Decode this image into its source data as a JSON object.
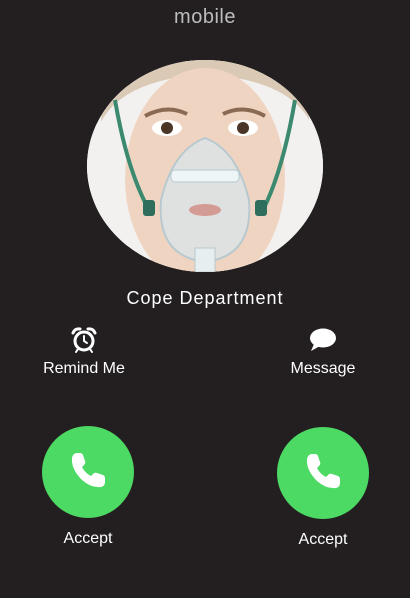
{
  "call": {
    "type_label": "mobile",
    "caller_name": "Cope Department"
  },
  "actions": {
    "remind_label": "Remind Me",
    "remind_icon": "alarm-clock-icon",
    "message_label": "Message",
    "message_icon": "speech-bubble-icon"
  },
  "buttons": {
    "accept_left_label": "Accept",
    "accept_right_label": "Accept",
    "accept_icon": "phone-handset-icon"
  },
  "colors": {
    "background": "#231f20",
    "accept_green": "#4cd964"
  }
}
